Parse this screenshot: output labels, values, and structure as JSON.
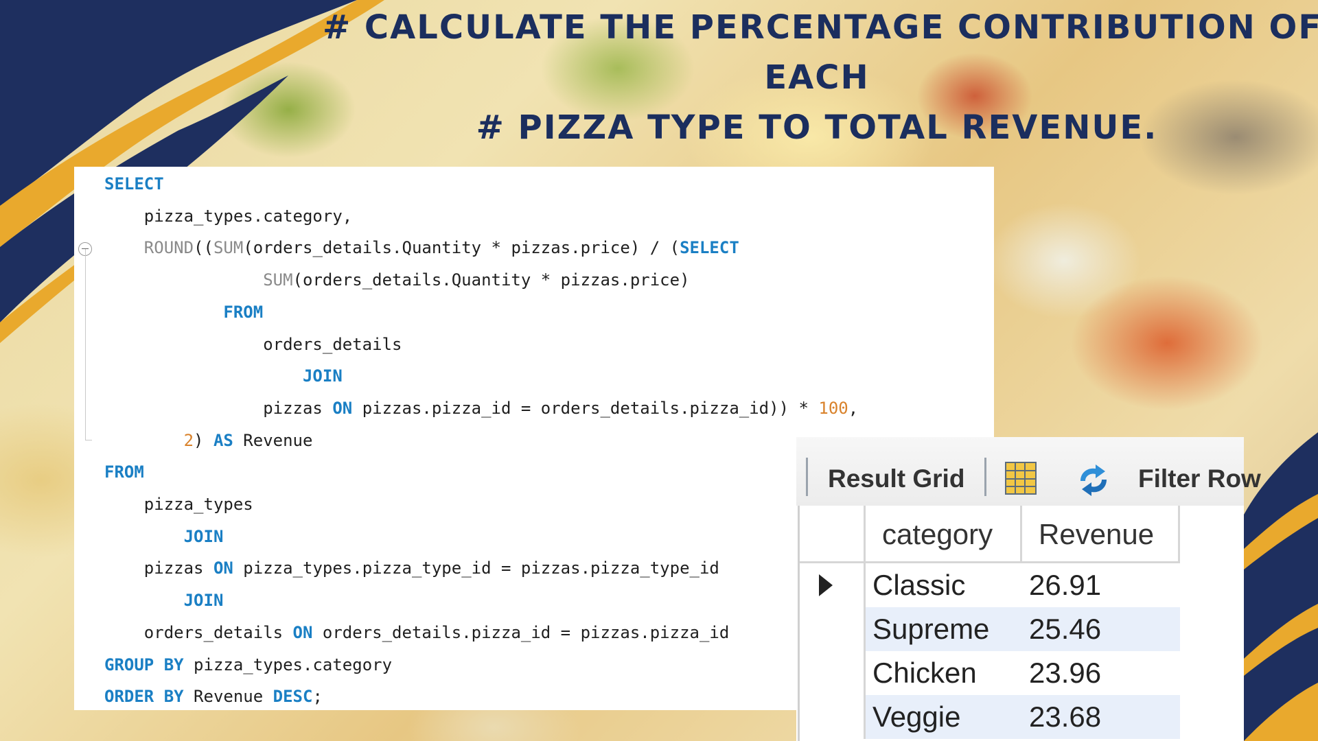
{
  "title": {
    "line1": "# CALCULATE THE PERCENTAGE CONTRIBUTION OF",
    "line2": "EACH",
    "line3": "# PIZZA TYPE TO TOTAL REVENUE."
  },
  "code": {
    "lines": [
      "SELECT",
      "    pizza_types.category,",
      "    ROUND((SUM(orders_details.Quantity * pizzas.price) / (SELECT",
      "                SUM(orders_details.Quantity * pizzas.price)",
      "            FROM",
      "                orders_details",
      "                    JOIN",
      "                pizzas ON pizzas.pizza_id = orders_details.pizza_id)) * 100,",
      "        2) AS Revenue",
      "FROM",
      "    pizza_types",
      "        JOIN",
      "    pizzas ON pizza_types.pizza_type_id = pizzas.pizza_type_id",
      "        JOIN",
      "    orders_details ON orders_details.pizza_id = pizzas.pizza_id",
      "GROUP BY pizza_types.category",
      "ORDER BY Revenue DESC;"
    ]
  },
  "result_grid": {
    "toolbar": {
      "result_grid_label": "Result Grid",
      "filter_rows_label": "Filter Row"
    },
    "columns": [
      "category",
      "Revenue"
    ],
    "rows": [
      {
        "category": "Classic",
        "revenue": "26.91",
        "selected": true
      },
      {
        "category": "Supreme",
        "revenue": "25.46",
        "selected": false
      },
      {
        "category": "Chicken",
        "revenue": "23.96",
        "selected": false
      },
      {
        "category": "Veggie",
        "revenue": "23.68",
        "selected": false
      }
    ]
  },
  "colors": {
    "title": "#1b2e5e",
    "navy_band": "#1e2f5f",
    "gold_band": "#e9a92d",
    "keyword": "#1a7fc4",
    "number": "#d9822b"
  }
}
